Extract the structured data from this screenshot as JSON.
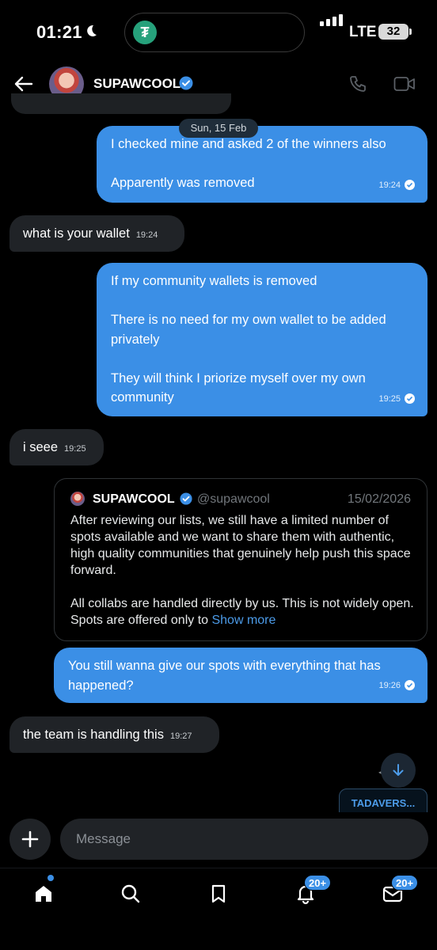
{
  "status_bar": {
    "time": "01:21",
    "network": "LTE",
    "battery": "32"
  },
  "header": {
    "contact_name": "SUPAWCOOL"
  },
  "date_divider": "Sun, 15 Feb",
  "messages": [
    {
      "text": "I checked mine and asked 2 of the winners also\n\nApparently was removed",
      "time": "19:24"
    },
    {
      "text": "what is your wallet",
      "time": "19:24"
    },
    {
      "text": "If my community wallets is removed\n\nThere is no need for my own wallet to be added privately\n\nThey will think I priorize myself over my own community",
      "time": "19:25"
    },
    {
      "text": "i seee",
      "time": "19:25"
    },
    {
      "text": "You still wanna give our spots with everything that has happened?",
      "time": "19:26"
    },
    {
      "text": "the team is handling this",
      "time": "19:27"
    }
  ],
  "quoted_post": {
    "name": "SUPAWCOOL",
    "handle": "@supawcool",
    "date": "15/02/2026",
    "body": "After reviewing our lists, we still have a limited number of spots available and we want to share them with authentic, high quality communities that genuinely help push this space forward.\n\nAll collabs are handled directly by us. This is not widely open. Spots are offered only to ",
    "show_more": "Show more"
  },
  "preview_chip": "TADAVERS...",
  "composer": {
    "placeholder": "Message"
  },
  "nav": {
    "notifications_badge": "20+",
    "messages_badge": "20+"
  },
  "colors": {
    "outgoing_bubble": "#3b8fe6",
    "incoming_bubble": "#202327",
    "accent": "#4c9be8"
  }
}
